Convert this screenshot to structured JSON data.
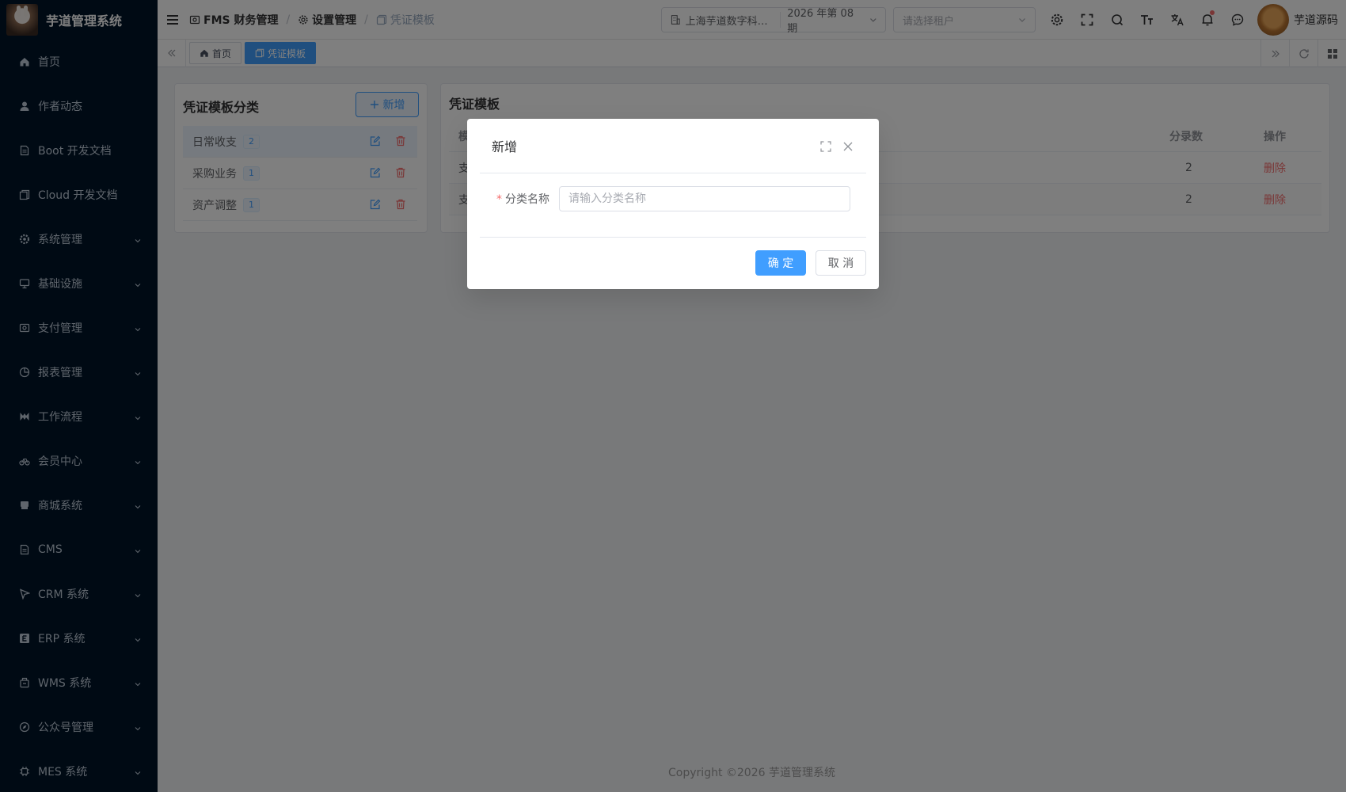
{
  "app": {
    "title": "芋道管理系统"
  },
  "sidebar": {
    "items": [
      {
        "label": "首页",
        "icon": "home-icon",
        "expandable": false
      },
      {
        "label": "作者动态",
        "icon": "user-icon",
        "expandable": false
      },
      {
        "label": "Boot 开发文档",
        "icon": "document-icon",
        "expandable": false
      },
      {
        "label": "Cloud 开发文档",
        "icon": "documents-icon",
        "expandable": false
      },
      {
        "label": "系统管理",
        "icon": "gear-icon",
        "expandable": true
      },
      {
        "label": "基础设施",
        "icon": "monitor-icon",
        "expandable": true
      },
      {
        "label": "支付管理",
        "icon": "payment-icon",
        "expandable": true
      },
      {
        "label": "报表管理",
        "icon": "pie-chart-icon",
        "expandable": true
      },
      {
        "label": "工作流程",
        "icon": "workflow-icon",
        "expandable": true
      },
      {
        "label": "会员中心",
        "icon": "bicycle-icon",
        "expandable": true
      },
      {
        "label": "商城系统",
        "icon": "shop-icon",
        "expandable": true
      },
      {
        "label": "CMS",
        "icon": "document-icon",
        "expandable": true
      },
      {
        "label": "CRM 系统",
        "icon": "crm-icon",
        "expandable": true
      },
      {
        "label": "ERP 系统",
        "icon": "erp-icon",
        "expandable": true
      },
      {
        "label": "WMS 系统",
        "icon": "warehouse-icon",
        "expandable": true
      },
      {
        "label": "公众号管理",
        "icon": "compass-icon",
        "expandable": true
      },
      {
        "label": "MES 系统",
        "icon": "chip-icon",
        "expandable": true
      }
    ]
  },
  "header": {
    "breadcrumb": [
      "FMS 财务管理",
      "设置管理",
      "凭证模板"
    ],
    "company": "上海芋道数字科…",
    "period": "2026 年第 08 期",
    "tenant_placeholder": "请选择租户",
    "user_name": "芋道源码",
    "notification_dot": true
  },
  "tags": [
    {
      "label": "首页",
      "active": false
    },
    {
      "label": "凭证模板",
      "active": true
    }
  ],
  "left_panel": {
    "title": "凭证模板分类",
    "add_label": "新增",
    "categories": [
      {
        "name": "日常收支",
        "count": "2",
        "selected": true
      },
      {
        "name": "采购业务",
        "count": "1",
        "selected": false
      },
      {
        "name": "资产调整",
        "count": "1",
        "selected": false
      }
    ]
  },
  "right_panel": {
    "title": "凭证模板",
    "columns": {
      "name": "模",
      "entries": "分录数",
      "ops": "操作"
    },
    "rows": [
      {
        "name": "支",
        "entries": "2",
        "op": "删除"
      },
      {
        "name": "支",
        "entries": "2",
        "op": "删除"
      }
    ]
  },
  "footer": {
    "copyright": "Copyright ©2026 芋道管理系统"
  },
  "dialog": {
    "title": "新增",
    "field_label": "分类名称",
    "field_placeholder": "请输入分类名称",
    "field_value": "",
    "required": true,
    "confirm_label": "确 定",
    "cancel_label": "取 消"
  },
  "colors": {
    "primary": "#409eff",
    "danger": "#f56c6c",
    "sidebar_bg": "#001529"
  }
}
